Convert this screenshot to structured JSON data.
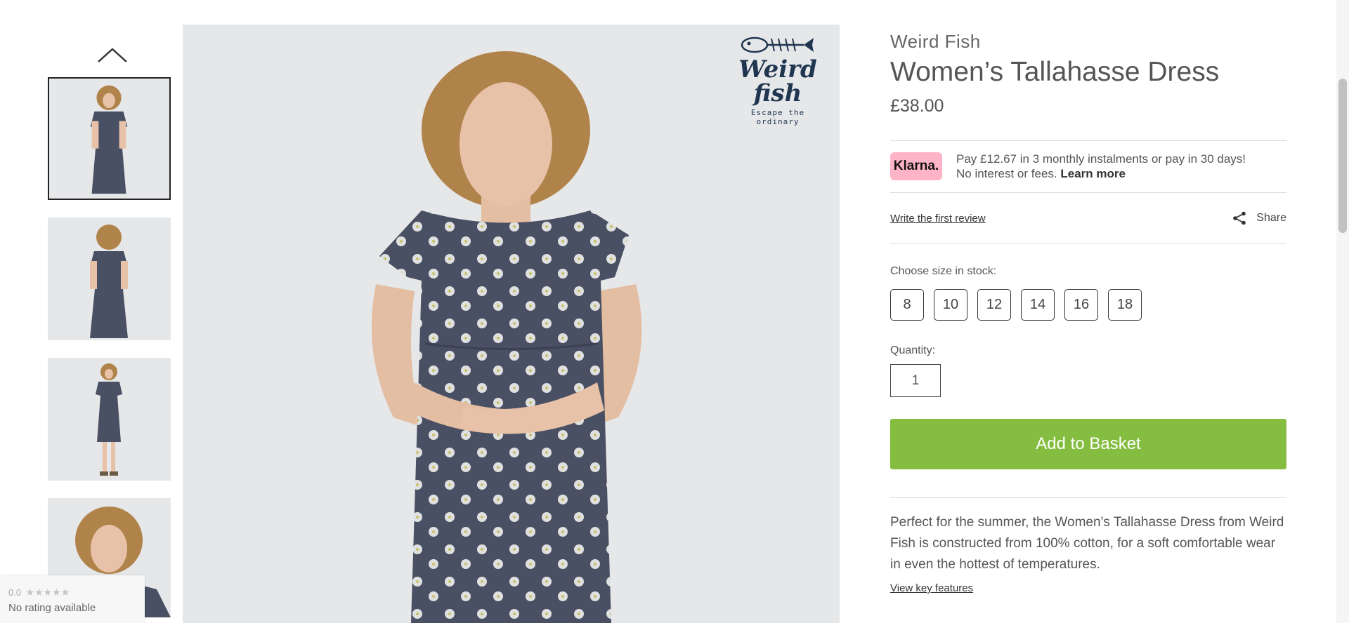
{
  "gallery": {
    "thumbnails": [
      {
        "alt": "front",
        "selected": true
      },
      {
        "alt": "back",
        "selected": false
      },
      {
        "alt": "full-length",
        "selected": false
      },
      {
        "alt": "close-up",
        "selected": false
      }
    ],
    "logo": {
      "word": "Weird fish",
      "tagline": "Escape the ordinary"
    }
  },
  "product": {
    "brand": "Weird Fish",
    "title": "Women’s Tallahasse Dress",
    "price": "£38.00",
    "klarna": {
      "badge": "Klarna.",
      "line1": "Pay £12.67 in 3 monthly instalments or pay in 30 days!",
      "line2": "No interest or fees.",
      "learn_more": "Learn more"
    },
    "review_link": "Write the first review",
    "share_label": "Share",
    "size_label": "Choose size in stock:",
    "sizes": [
      "8",
      "10",
      "12",
      "14",
      "16",
      "18"
    ],
    "quantity_label": "Quantity:",
    "quantity_value": "1",
    "add_to_basket": "Add to Basket",
    "description": "Perfect for the summer, the Women’s Tallahasse Dress from Weird Fish is constructed from 100% cotton, for a soft comfortable wear in even the hottest of temperatures.",
    "key_features_link": "View key features"
  },
  "rating_widget": {
    "score": "0.0",
    "stars": "★★★★★",
    "status": "No rating available"
  },
  "colors": {
    "basket_green": "#84bd3f",
    "klarna_pink": "#ffb3c7",
    "dress_navy": "#4a5063"
  }
}
